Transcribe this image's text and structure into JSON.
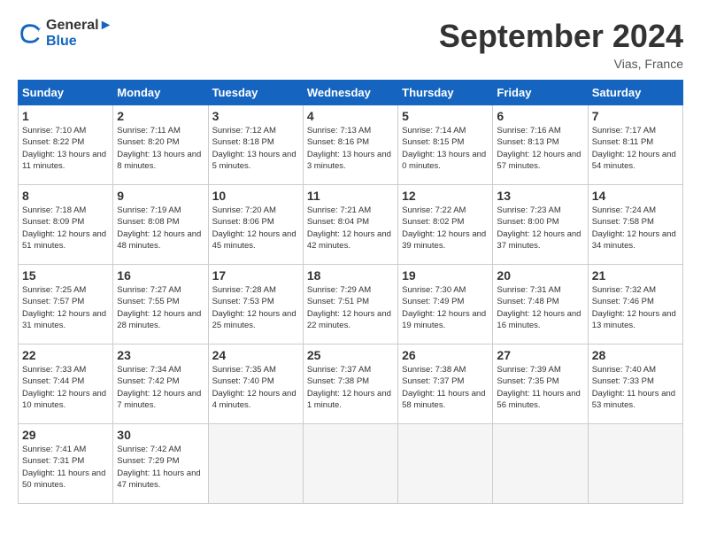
{
  "header": {
    "logo_line1": "General",
    "logo_line2": "Blue",
    "month_title": "September 2024",
    "location": "Vias, France"
  },
  "weekdays": [
    "Sunday",
    "Monday",
    "Tuesday",
    "Wednesday",
    "Thursday",
    "Friday",
    "Saturday"
  ],
  "days": [
    {
      "date": 1,
      "sunrise": "7:10 AM",
      "sunset": "8:22 PM",
      "daylight": "13 hours and 11 minutes."
    },
    {
      "date": 2,
      "sunrise": "7:11 AM",
      "sunset": "8:20 PM",
      "daylight": "13 hours and 8 minutes."
    },
    {
      "date": 3,
      "sunrise": "7:12 AM",
      "sunset": "8:18 PM",
      "daylight": "13 hours and 5 minutes."
    },
    {
      "date": 4,
      "sunrise": "7:13 AM",
      "sunset": "8:16 PM",
      "daylight": "13 hours and 3 minutes."
    },
    {
      "date": 5,
      "sunrise": "7:14 AM",
      "sunset": "8:15 PM",
      "daylight": "13 hours and 0 minutes."
    },
    {
      "date": 6,
      "sunrise": "7:16 AM",
      "sunset": "8:13 PM",
      "daylight": "12 hours and 57 minutes."
    },
    {
      "date": 7,
      "sunrise": "7:17 AM",
      "sunset": "8:11 PM",
      "daylight": "12 hours and 54 minutes."
    },
    {
      "date": 8,
      "sunrise": "7:18 AM",
      "sunset": "8:09 PM",
      "daylight": "12 hours and 51 minutes."
    },
    {
      "date": 9,
      "sunrise": "7:19 AM",
      "sunset": "8:08 PM",
      "daylight": "12 hours and 48 minutes."
    },
    {
      "date": 10,
      "sunrise": "7:20 AM",
      "sunset": "8:06 PM",
      "daylight": "12 hours and 45 minutes."
    },
    {
      "date": 11,
      "sunrise": "7:21 AM",
      "sunset": "8:04 PM",
      "daylight": "12 hours and 42 minutes."
    },
    {
      "date": 12,
      "sunrise": "7:22 AM",
      "sunset": "8:02 PM",
      "daylight": "12 hours and 39 minutes."
    },
    {
      "date": 13,
      "sunrise": "7:23 AM",
      "sunset": "8:00 PM",
      "daylight": "12 hours and 37 minutes."
    },
    {
      "date": 14,
      "sunrise": "7:24 AM",
      "sunset": "7:58 PM",
      "daylight": "12 hours and 34 minutes."
    },
    {
      "date": 15,
      "sunrise": "7:25 AM",
      "sunset": "7:57 PM",
      "daylight": "12 hours and 31 minutes."
    },
    {
      "date": 16,
      "sunrise": "7:27 AM",
      "sunset": "7:55 PM",
      "daylight": "12 hours and 28 minutes."
    },
    {
      "date": 17,
      "sunrise": "7:28 AM",
      "sunset": "7:53 PM",
      "daylight": "12 hours and 25 minutes."
    },
    {
      "date": 18,
      "sunrise": "7:29 AM",
      "sunset": "7:51 PM",
      "daylight": "12 hours and 22 minutes."
    },
    {
      "date": 19,
      "sunrise": "7:30 AM",
      "sunset": "7:49 PM",
      "daylight": "12 hours and 19 minutes."
    },
    {
      "date": 20,
      "sunrise": "7:31 AM",
      "sunset": "7:48 PM",
      "daylight": "12 hours and 16 minutes."
    },
    {
      "date": 21,
      "sunrise": "7:32 AM",
      "sunset": "7:46 PM",
      "daylight": "12 hours and 13 minutes."
    },
    {
      "date": 22,
      "sunrise": "7:33 AM",
      "sunset": "7:44 PM",
      "daylight": "12 hours and 10 minutes."
    },
    {
      "date": 23,
      "sunrise": "7:34 AM",
      "sunset": "7:42 PM",
      "daylight": "12 hours and 7 minutes."
    },
    {
      "date": 24,
      "sunrise": "7:35 AM",
      "sunset": "7:40 PM",
      "daylight": "12 hours and 4 minutes."
    },
    {
      "date": 25,
      "sunrise": "7:37 AM",
      "sunset": "7:38 PM",
      "daylight": "12 hours and 1 minute."
    },
    {
      "date": 26,
      "sunrise": "7:38 AM",
      "sunset": "7:37 PM",
      "daylight": "11 hours and 58 minutes."
    },
    {
      "date": 27,
      "sunrise": "7:39 AM",
      "sunset": "7:35 PM",
      "daylight": "11 hours and 56 minutes."
    },
    {
      "date": 28,
      "sunrise": "7:40 AM",
      "sunset": "7:33 PM",
      "daylight": "11 hours and 53 minutes."
    },
    {
      "date": 29,
      "sunrise": "7:41 AM",
      "sunset": "7:31 PM",
      "daylight": "11 hours and 50 minutes."
    },
    {
      "date": 30,
      "sunrise": "7:42 AM",
      "sunset": "7:29 PM",
      "daylight": "11 hours and 47 minutes."
    }
  ],
  "labels": {
    "sunrise": "Sunrise:",
    "sunset": "Sunset:",
    "daylight": "Daylight:"
  }
}
